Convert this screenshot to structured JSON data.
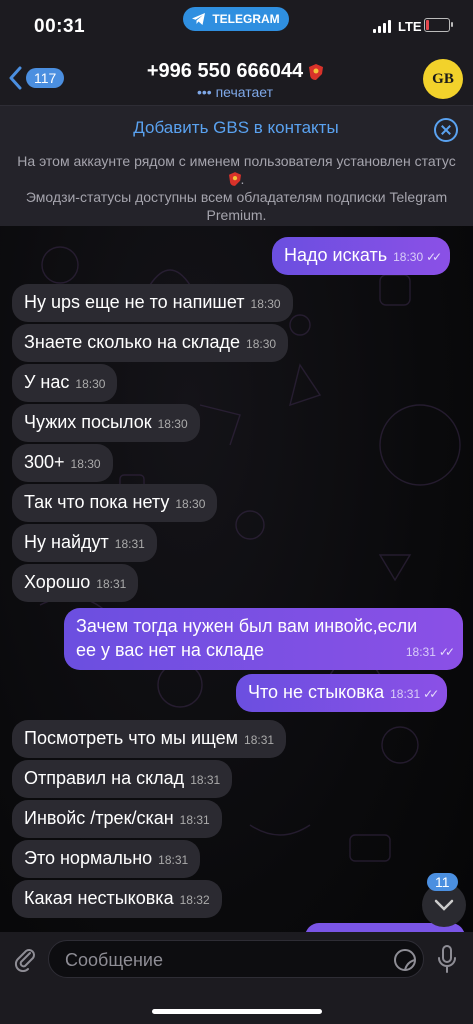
{
  "status_bar": {
    "time": "00:31",
    "pill": "TELEGRAM",
    "network": "LTE",
    "battery_level": 0.12
  },
  "header": {
    "back_count": "117",
    "title": "+996 550 666044",
    "subtitle": "печатает",
    "avatar_text": "GB"
  },
  "banner": {
    "add_contact": "Добавить GBS в контакты",
    "notice_line1": "На этом аккаунте рядом с именем пользователя установлен статус",
    "notice_line2": "Эмодзи-статусы доступны всем обладателям подписки Telegram Premium."
  },
  "messages": [
    {
      "dir": "out",
      "text": "Надо искать",
      "time": "18:30"
    },
    {
      "dir": "in",
      "text": "Ну ups еще не то напишет",
      "time": "18:30"
    },
    {
      "dir": "in",
      "text": "Знаете сколько на складе",
      "time": "18:30"
    },
    {
      "dir": "in",
      "text": "У нас",
      "time": "18:30"
    },
    {
      "dir": "in",
      "text": "Чужих посылок",
      "time": "18:30"
    },
    {
      "dir": "in",
      "text": "300+",
      "time": "18:30"
    },
    {
      "dir": "in",
      "text": "Так что пока нету",
      "time": "18:30"
    },
    {
      "dir": "in",
      "text": "Ну найдут",
      "time": "18:31"
    },
    {
      "dir": "in",
      "text": "Хорошо",
      "time": "18:31"
    },
    {
      "dir": "out",
      "text": "Зачем тогда нужен был вам инвойс,если ее у вас нет на складе",
      "line1": "Зачем тогда нужен был вам инвойс,если",
      "line2": "ее у вас нет на складе",
      "time": "18:31"
    },
    {
      "dir": "out",
      "text": "Что не стыковка",
      "time": "18:31"
    },
    {
      "dir": "in",
      "text": "Посмотреть что мы ищем",
      "time": "18:31"
    },
    {
      "dir": "in",
      "text": "Отправил на склад",
      "time": "18:31"
    },
    {
      "dir": "in",
      "text": "Инвойс /трек/скан",
      "time": "18:31"
    },
    {
      "dir": "in",
      "text": "Это нормально",
      "time": "18:31"
    },
    {
      "dir": "in",
      "text": "Какая нестыковка",
      "time": "18:32"
    }
  ],
  "unread_count": "11",
  "composer": {
    "placeholder": "Сообщение"
  },
  "colors": {
    "accent": "#5aa2f0",
    "outgoing": "#7a55e6",
    "incoming": "#2b2a31"
  }
}
